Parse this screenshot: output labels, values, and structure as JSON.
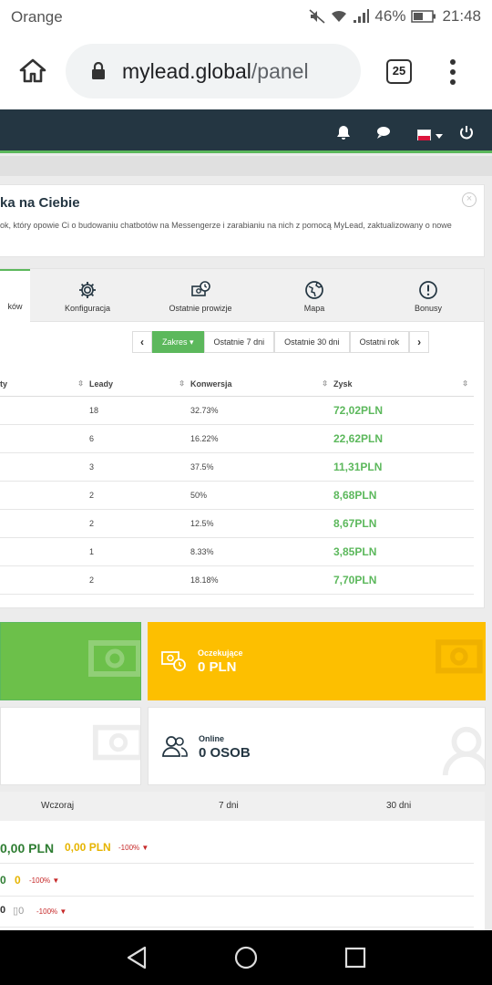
{
  "status_bar": {
    "carrier": "Orange",
    "battery": "46%",
    "time": "21:48"
  },
  "browser": {
    "url_domain": "mylead.global",
    "url_path": "/panel",
    "tab_count": "25"
  },
  "notice": {
    "title": "ka na Ciebie",
    "body": "ok, który opowie Ci o budowaniu chatbotów na Messengerze i zarabianiu na nich z pomocą MyLead, zaktualizowany o nowe"
  },
  "tabs": [
    {
      "label": "ków",
      "icon": "list-icon"
    },
    {
      "label": "Konfiguracja",
      "icon": "gear-icon"
    },
    {
      "label": "Ostatnie prowizje",
      "icon": "commission-icon"
    },
    {
      "label": "Mapa",
      "icon": "globe-icon"
    },
    {
      "label": "Bonusy",
      "icon": "exclamation-icon"
    }
  ],
  "filters": {
    "range": "Zakres",
    "last7": "Ostatnie 7 dni",
    "last30": "Ostatnie 30 dni",
    "lastYear": "Ostatni rok"
  },
  "table": {
    "headers": [
      "ty",
      "Leady",
      "Konwersja",
      "Zysk"
    ],
    "rows": [
      {
        "leads": "18",
        "conversion": "32.73%",
        "profit": "72,02PLN"
      },
      {
        "leads": "6",
        "conversion": "16.22%",
        "profit": "22,62PLN"
      },
      {
        "leads": "3",
        "conversion": "37.5%",
        "profit": "11,31PLN"
      },
      {
        "leads": "2",
        "conversion": "50%",
        "profit": "8,68PLN"
      },
      {
        "leads": "2",
        "conversion": "12.5%",
        "profit": "8,67PLN"
      },
      {
        "leads": "1",
        "conversion": "8.33%",
        "profit": "3,85PLN"
      },
      {
        "leads": "2",
        "conversion": "18.18%",
        "profit": "7,70PLN"
      }
    ]
  },
  "cards": {
    "pending": {
      "label": "Oczekujące",
      "value": "0 PLN"
    },
    "online": {
      "label": "Online",
      "value": "0 OSOB"
    }
  },
  "stats": {
    "columns": [
      "Wczoraj",
      "7 dni",
      "30 dni"
    ],
    "rows": [
      {
        "a": "0,00 PLN",
        "b": "0,00 PLN",
        "c": "-100%"
      },
      {
        "a": "0",
        "b": "0",
        "c": "-100%"
      },
      {
        "a": "0",
        "b": "0",
        "c": "-100%"
      }
    ]
  },
  "colors": {
    "accent_green": "#5cb85c",
    "header": "#243642",
    "pending": "#fdbf00"
  }
}
